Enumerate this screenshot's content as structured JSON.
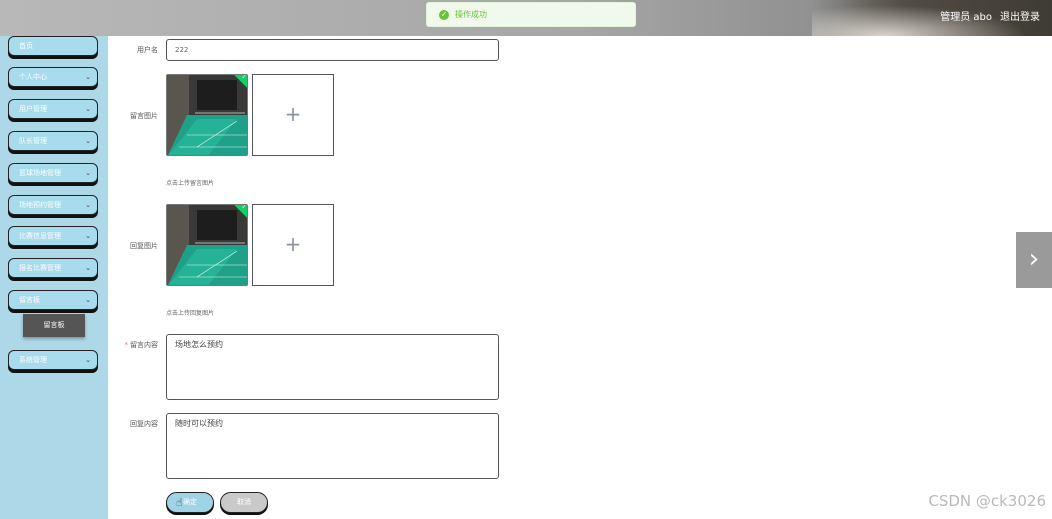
{
  "header": {
    "user_label": "管理员 abo",
    "logout_label": "退出登录"
  },
  "toast": {
    "message": "操作成功",
    "color": "#67c23a"
  },
  "sidebar": {
    "items": [
      {
        "label": "首页"
      },
      {
        "label": "个人中心"
      },
      {
        "label": "用户管理"
      },
      {
        "label": "队长管理"
      },
      {
        "label": "篮球场地管理"
      },
      {
        "label": "场地预约管理"
      },
      {
        "label": "比赛信息管理"
      },
      {
        "label": "报名比赛管理"
      },
      {
        "label": "留言板"
      },
      {
        "label": "系统管理"
      }
    ],
    "submenu_item": "留言板",
    "chevron": "⌄"
  },
  "form": {
    "username": {
      "label": "用户名",
      "value": "222"
    },
    "message_image": {
      "label": "留言图片",
      "tip": "点击上传留言图片"
    },
    "reply_image": {
      "label": "回复图片",
      "tip": "点击上传回复图片"
    },
    "message_content": {
      "label": "留言内容",
      "value": "场地怎么预约"
    },
    "reply_content": {
      "label": "回复内容",
      "value": "随时可以预约"
    },
    "confirm_button": "确定",
    "cancel_button": "取消"
  },
  "icons": {
    "plus": "+",
    "check": "✓",
    "next": "›"
  },
  "colors": {
    "sidebar_bg": "#acd8e7",
    "success": "#13ce66"
  },
  "watermark": "CSDN @ck3026"
}
